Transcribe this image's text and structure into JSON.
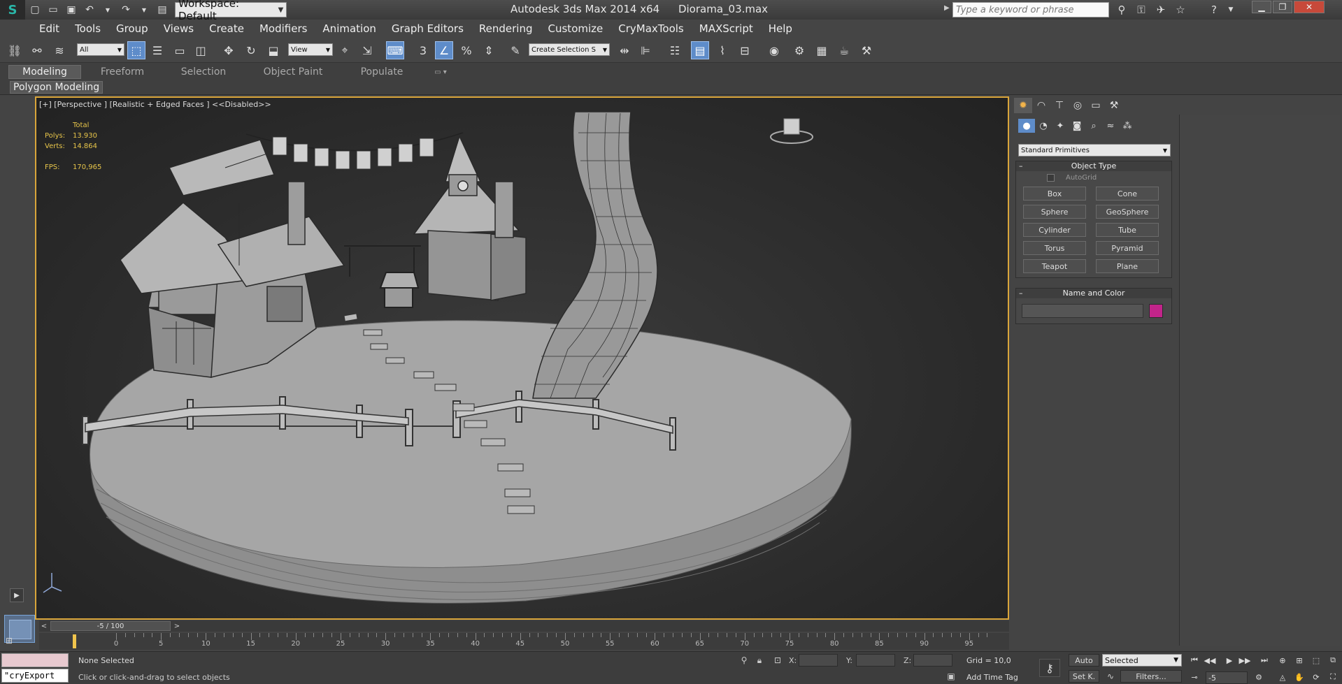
{
  "titlebar": {
    "workspace": "Workspace: Default",
    "app_title": "Autodesk 3ds Max  2014 x64",
    "file_name": "Diorama_03.max",
    "search_placeholder": "Type a keyword or phrase"
  },
  "menu": [
    "Edit",
    "Tools",
    "Group",
    "Views",
    "Create",
    "Modifiers",
    "Animation",
    "Graph Editors",
    "Rendering",
    "Customize",
    "CryMaxTools",
    "MAXScript",
    "Help"
  ],
  "toolbar": {
    "selection_filter": "All",
    "ref_coord": "View",
    "named_selection": "Create Selection S"
  },
  "ribbon": {
    "tabs": [
      "Modeling",
      "Freeform",
      "Selection",
      "Object Paint",
      "Populate"
    ],
    "active_tab": "Modeling",
    "panel_label": "Polygon Modeling"
  },
  "viewport": {
    "label": "[+] [Perspective ] [Realistic + Edged Faces ]  <<Disabled>>",
    "stats": {
      "total_label": "Total",
      "polys_label": "Polys:",
      "polys_value": "13.930",
      "verts_label": "Verts:",
      "verts_value": "14.864",
      "fps_label": "FPS:",
      "fps_value": "170,965"
    }
  },
  "command_panel": {
    "category_dropdown": "Standard Primitives",
    "object_type_title": "Object Type",
    "autogrid_label": "AutoGrid",
    "primitives": [
      "Box",
      "Cone",
      "Sphere",
      "GeoSphere",
      "Cylinder",
      "Tube",
      "Torus",
      "Pyramid",
      "Teapot",
      "Plane"
    ],
    "name_color_title": "Name and Color",
    "object_color": "#c2248a"
  },
  "timeline": {
    "slider_label": "-5 / 100",
    "ticks": [
      "0",
      "5",
      "10",
      "15",
      "20",
      "25",
      "30",
      "35",
      "40",
      "45",
      "50",
      "55",
      "60",
      "65",
      "70",
      "75",
      "80",
      "85",
      "90",
      "95"
    ]
  },
  "status": {
    "maxscript_listener": "\"cryExport",
    "selection_status": "None Selected",
    "prompt": "Click or click-and-drag to select objects",
    "x_label": "X:",
    "y_label": "Y:",
    "z_label": "Z:",
    "grid": "Grid = 10,0",
    "add_time_tag": "Add Time Tag",
    "auto_key": "Auto",
    "set_key": "Set K.",
    "key_mode": "Selected",
    "filters": "Filters...",
    "current_frame": "-5"
  }
}
